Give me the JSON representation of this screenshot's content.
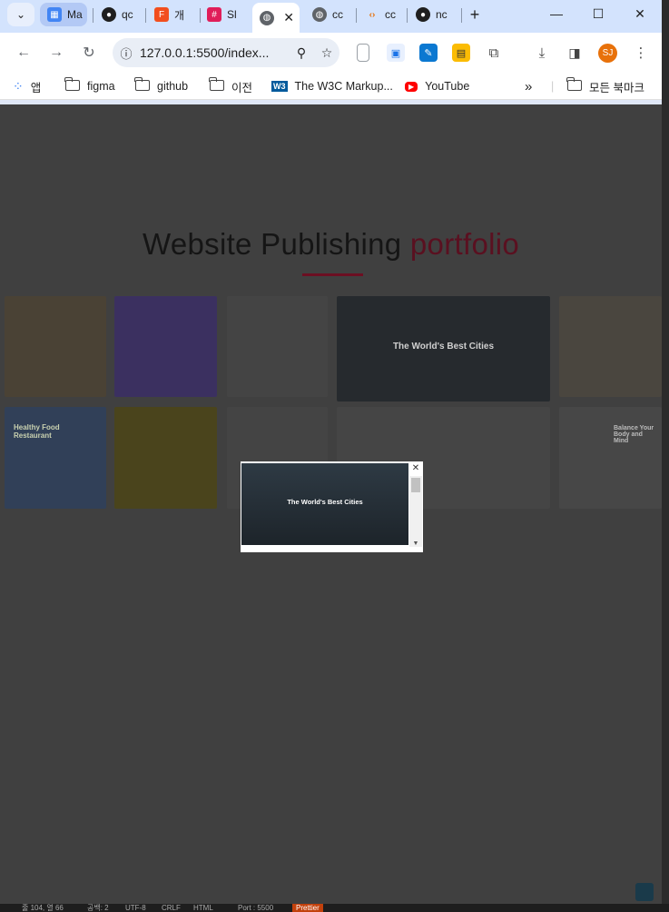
{
  "tabs": [
    {
      "label": "Ma",
      "color": "#4285f4"
    },
    {
      "label": "qc",
      "color": "#1f1f1f"
    },
    {
      "label": "개",
      "color": "#f24e1e"
    },
    {
      "label": "Sl",
      "color": "#e01e5a"
    },
    {
      "label": "",
      "color": "#5f6368",
      "active": true
    },
    {
      "label": "cc",
      "color": "#5f6368"
    },
    {
      "label": "cc",
      "color": "#e8710a"
    },
    {
      "label": "nc",
      "color": "#1f1f1f"
    }
  ],
  "address_bar": {
    "url": "127.0.0.1:5500/index..."
  },
  "profile": {
    "initials": "SJ"
  },
  "bookmarks": [
    {
      "label": "앱"
    },
    {
      "label": "figma"
    },
    {
      "label": "github"
    },
    {
      "label": "이전"
    },
    {
      "label": "The W3C Markup..."
    },
    {
      "label": "YouTube"
    },
    {
      "label": "모든 북마크"
    }
  ],
  "page": {
    "heading_main": "Website Publishing ",
    "heading_accent": "portfolio",
    "thumbnails": [
      {
        "title": "Healthy Food Restaurant"
      },
      {
        "title": "The World's Best Cities"
      },
      {
        "title": "Balance Your Body and Mind"
      }
    ],
    "popup_title": "The World's Best Cities"
  },
  "statusbar": {
    "items": [
      "줄 104, 열 66",
      "공백: 2",
      "UTF-8",
      "CRLF",
      "HTML",
      "Port : 5500",
      "Prettier"
    ]
  },
  "colors": {
    "accent": "#6c0f22",
    "overlay": "#404040",
    "tab_strip": "#d3e3fd"
  }
}
